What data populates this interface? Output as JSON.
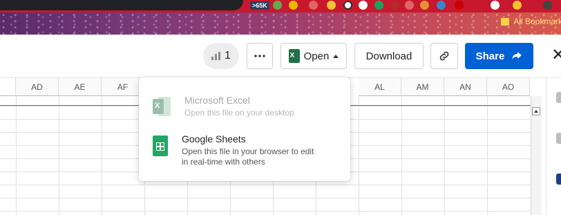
{
  "browser": {
    "extension_badge": "65K",
    "bookmarks_label": "All Bookmarks"
  },
  "header": {
    "view_count": "1",
    "open_label": "Open",
    "download_label": "Download",
    "share_label": "Share"
  },
  "sheet": {
    "columns_left": [
      "AD",
      "AE",
      "AF"
    ],
    "columns_right": [
      "AL",
      "AM",
      "AN",
      "AO"
    ]
  },
  "open_menu": {
    "items": [
      {
        "title": "Microsoft Excel",
        "description": "Open this file on your desktop",
        "enabled": false
      },
      {
        "title": "Google Sheets",
        "description": "Open this file in your browser to edit in real-time with others",
        "enabled": true
      }
    ]
  },
  "colors": {
    "share_button": "#0061d5",
    "excel_green": "#1e7145",
    "sheets_green": "#23a566"
  },
  "icons": [
    "stats-icon",
    "more-icon",
    "excel-icon",
    "caret-up-icon",
    "link-icon",
    "share-arrow-icon",
    "close-icon",
    "google-sheets-icon"
  ]
}
